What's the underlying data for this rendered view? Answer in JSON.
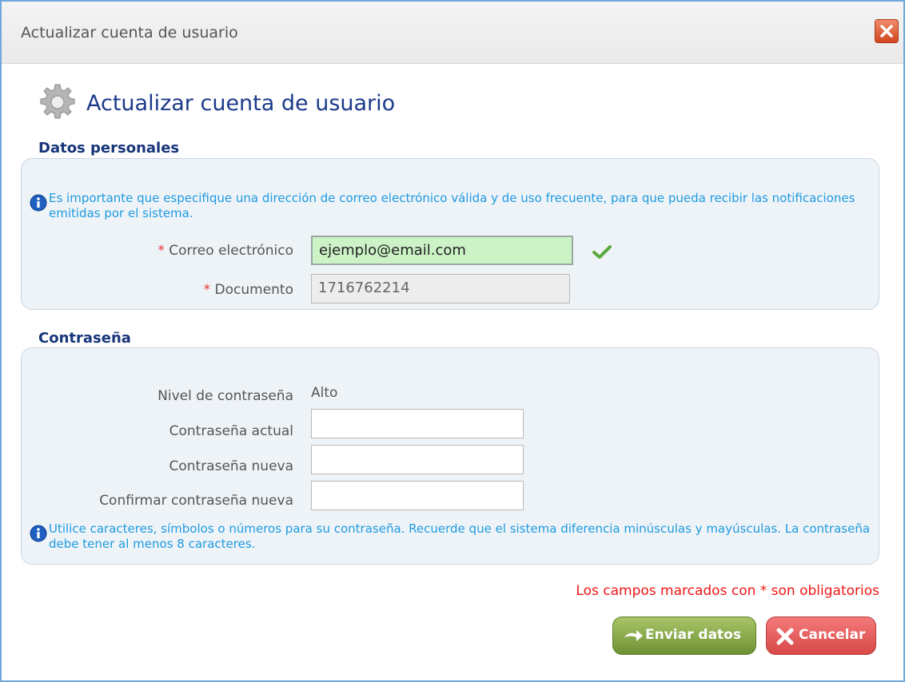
{
  "window": {
    "title": "Actualizar cuenta de usuario"
  },
  "header": {
    "title": "Actualizar cuenta de usuario",
    "icon": "gear-icon"
  },
  "personal": {
    "section_title": "Datos personales",
    "info_text": "Es importante que especifique una dirección de correo electrónico válida y de uso frecuente, para que pueda recibir las notificaciones emitidas por el sistema.",
    "email_label": "Correo electrónico",
    "email_value": "ejemplo@email.com",
    "document_label": "Documento",
    "document_value": "1716762214",
    "required_mark": "*"
  },
  "password": {
    "section_title": "Contraseña",
    "level_label": "Nivel de contraseña",
    "level_value": "Alto",
    "current_label": "Contraseña actual",
    "new_label": "Contraseña nueva",
    "confirm_label": "Confirmar contraseña nueva",
    "info_text": "Utilice caracteres, símbolos o números para su contraseña. Recuerde que el sistema diferencia minúsculas y mayúsculas. La contraseña debe tener al menos 8 caracteres."
  },
  "footer": {
    "required_note": "Los campos marcados con * son obligatorios",
    "send_label": "Enviar datos",
    "cancel_label": "Cancelar"
  },
  "colors": {
    "title": "#1c3a8a",
    "info": "#1f9be0",
    "required": "#ef1515",
    "valid_bg": "#ccf3c6"
  }
}
